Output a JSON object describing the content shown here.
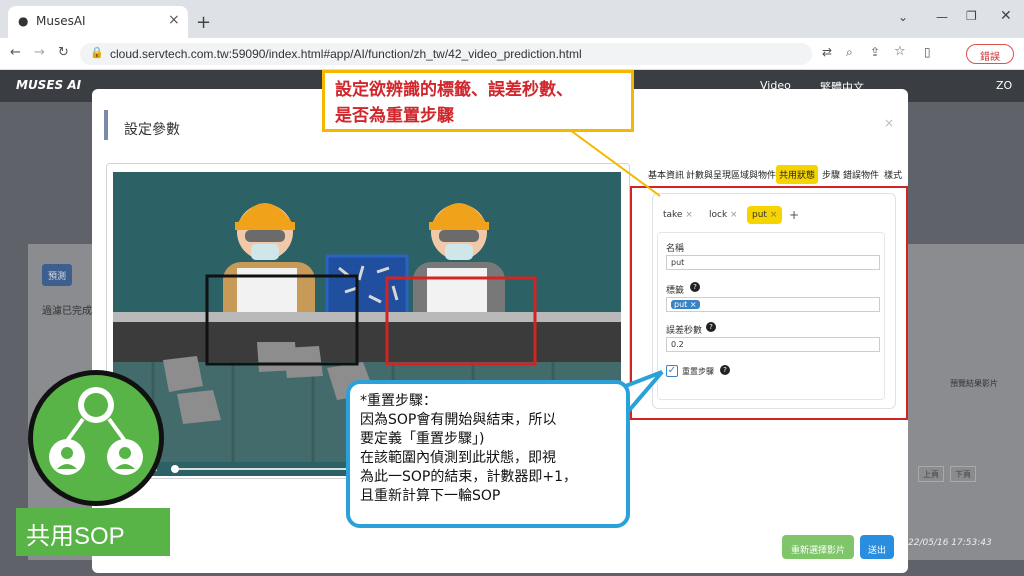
{
  "browser": {
    "tab_title": "MusesAI",
    "url": "cloud.servtech.com.tw:59090/index.html#app/AI/function/zh_tw/42_video_prediction.html",
    "error_label": "錯誤"
  },
  "app": {
    "logo": "MUSES AI",
    "header_items": [
      "Video",
      "繁體中文",
      "ZO"
    ],
    "bg_button": "預測",
    "bg_text": "過濾已完成",
    "bg_right_text": "預覽結果影片",
    "pager": [
      "上頁",
      "下頁"
    ],
    "timestamp": "22/05/16 17:53:43"
  },
  "modal": {
    "title": "設定參數",
    "close": "×",
    "tabs": [
      "基本資訊",
      "計數與呈現區域與物件",
      "共用狀態",
      "步驟",
      "錯誤物件",
      "樣式"
    ],
    "active_tab": "共用狀態",
    "state_chips": [
      {
        "label": "take",
        "active": false
      },
      {
        "label": "lock",
        "active": false
      },
      {
        "label": "put",
        "active": true
      }
    ],
    "add_symbol": "+",
    "name_label": "名稱",
    "name_value": "put",
    "tag_label": "標籤",
    "tag_chip": "put",
    "tolerance_label": "誤差秒數",
    "tolerance_value": "0.2",
    "reset_label": "重置步驟",
    "reset_checked": true,
    "reselect_button": "重新選擇影片",
    "submit_button": "送出"
  },
  "annotations": {
    "top_callout": [
      "設定欲辨識的標籤、誤差秒數、",
      "是否為重置步驟"
    ],
    "bubble": [
      "*重置步驟：",
      "因為SOP會有開始與結束，所以",
      "要定義「重置步驟」)",
      "在該範圍內偵測到此狀態，即視",
      "為此一SOP的結束，計數器即+1，",
      "且重新計算下一輪SOP"
    ],
    "sop_label": "共用SOP"
  },
  "colors": {
    "accent_yellow": "#f5b800",
    "red": "#d32424",
    "blue": "#2aa1d8",
    "green": "#58b447"
  }
}
